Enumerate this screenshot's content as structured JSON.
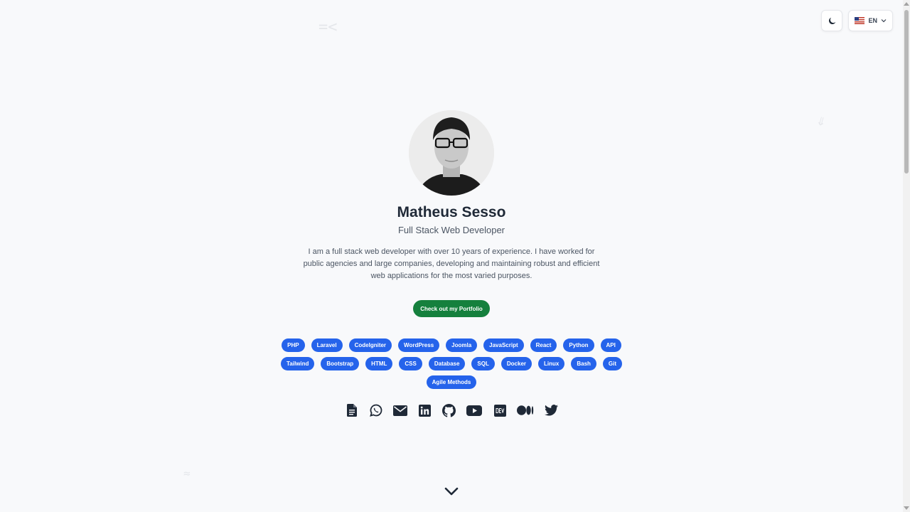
{
  "profile": {
    "name": "Matheus Sesso",
    "role": "Full Stack Web Developer",
    "bio": "I am a full stack web developer with over 10 years of experience. I have worked for public agencies and large companies, developing and maintaining robust and efficient web applications for the most varied purposes.",
    "portfolio_label": "Check out my Portfolio"
  },
  "controls": {
    "theme_icon": "moon-icon",
    "language": "EN",
    "language_flag": "us-flag-icon"
  },
  "skills": [
    "PHP",
    "Laravel",
    "CodeIgniter",
    "WordPress",
    "Joomla",
    "JavaScript",
    "React",
    "Python",
    "API",
    "Tailwind",
    "Bootstrap",
    "HTML",
    "CSS",
    "Database",
    "SQL",
    "Docker",
    "Linux",
    "Bash",
    "Git",
    "Agile Methods"
  ],
  "social_icons": [
    "resume-icon",
    "whatsapp-icon",
    "email-icon",
    "linkedin-icon",
    "github-icon",
    "youtube-icon",
    "dev-icon",
    "medium-icon",
    "twitter-icon"
  ],
  "scroll_icon": "chevron-down-icon",
  "colors": {
    "background": "#f8f9fb",
    "portfolio_button": "#15803d",
    "skill_tag": "#2563eb",
    "text_primary": "#1f2937"
  }
}
